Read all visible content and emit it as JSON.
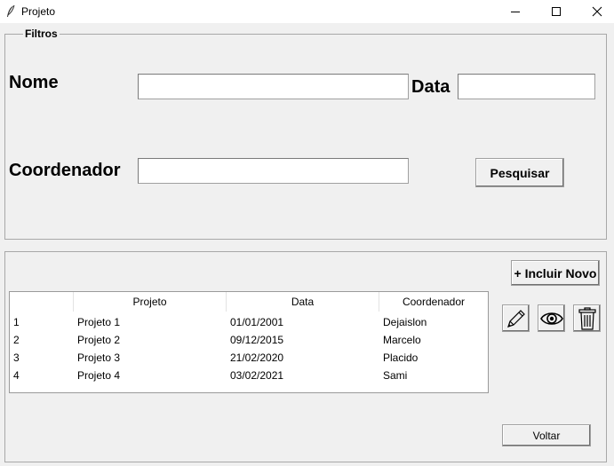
{
  "window": {
    "title": "Projeto"
  },
  "filtros": {
    "legend": "Filtros",
    "nome_label": "Nome",
    "nome_value": "",
    "data_label": "Data",
    "data_value": "",
    "coordenador_label": "Coordenador",
    "coordenador_value": "",
    "pesquisar_label": "Pesquisar"
  },
  "lista": {
    "incluir_label": "+ Incluir Novo",
    "columns": [
      "",
      "Projeto",
      "Data",
      "Coordenador"
    ],
    "rows": [
      [
        "1",
        "Projeto 1",
        "01/01/2001",
        "Dejaislon"
      ],
      [
        "2",
        "Projeto 2",
        "09/12/2015",
        "Marcelo"
      ],
      [
        "3",
        "Projeto 3",
        "21/02/2020",
        "Placido"
      ],
      [
        "4",
        "Projeto 4",
        "03/02/2021",
        "Sami"
      ]
    ],
    "actions": [
      "pencil-icon",
      "eye-icon",
      "trash-icon"
    ],
    "voltar_label": "Voltar"
  }
}
